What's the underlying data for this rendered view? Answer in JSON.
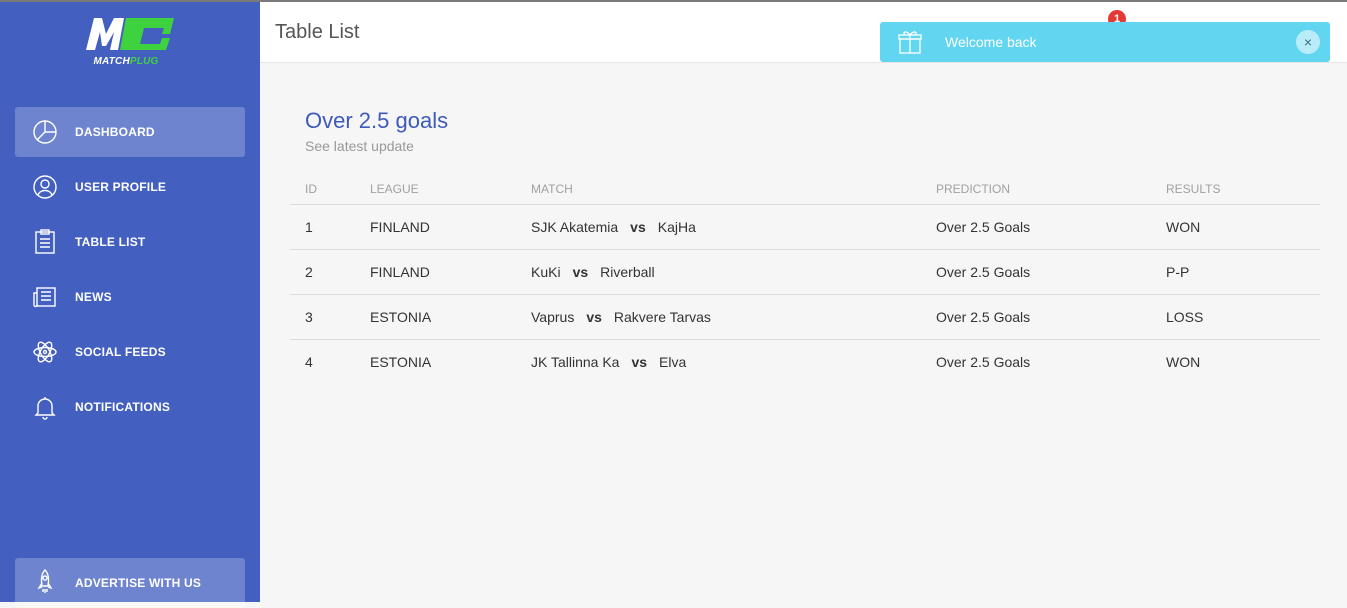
{
  "brand": {
    "logo_text_match": "MATCH",
    "logo_text_plug": "PLUG",
    "primary_color": "#435fc0",
    "accent_green": "#3fd23f"
  },
  "sidebar": {
    "items": [
      {
        "label": "DASHBOARD",
        "icon": "pie-chart-icon",
        "active": true
      },
      {
        "label": "USER PROFILE",
        "icon": "user-icon",
        "active": false
      },
      {
        "label": "TABLE LIST",
        "icon": "clipboard-icon",
        "active": false
      },
      {
        "label": "NEWS",
        "icon": "newspaper-icon",
        "active": false
      },
      {
        "label": "SOCIAL FEEDS",
        "icon": "atom-icon",
        "active": false
      },
      {
        "label": "NOTIFICATIONS",
        "icon": "bell-icon",
        "active": false
      }
    ],
    "advertise": {
      "label": "ADVERTISE WITH US",
      "icon": "rocket-icon"
    }
  },
  "header": {
    "title": "Table List",
    "notification_count": "1"
  },
  "toast": {
    "message": "Welcome back",
    "icon": "gift-icon",
    "close_label": "×",
    "color": "#62d5f0"
  },
  "card": {
    "title": "Over 2.5 goals",
    "subtitle": "See latest update"
  },
  "table": {
    "columns": [
      "ID",
      "LEAGUE",
      "MATCH",
      "PREDICTION",
      "RESULTS"
    ],
    "vs_label": "vs",
    "rows": [
      {
        "id": "1",
        "league": "FINLAND",
        "home": "SJK Akatemia",
        "away": "KajHa",
        "prediction": "Over 2.5 Goals",
        "result": "WON"
      },
      {
        "id": "2",
        "league": "FINLAND",
        "home": "KuKi",
        "away": "Riverball",
        "prediction": "Over 2.5 Goals",
        "result": "P-P"
      },
      {
        "id": "3",
        "league": "ESTONIA",
        "home": "Vaprus",
        "away": "Rakvere Tarvas",
        "prediction": "Over 2.5 Goals",
        "result": "LOSS"
      },
      {
        "id": "4",
        "league": "ESTONIA",
        "home": "JK Tallinna Ka",
        "away": "Elva",
        "prediction": "Over 2.5 Goals",
        "result": "WON"
      }
    ]
  }
}
